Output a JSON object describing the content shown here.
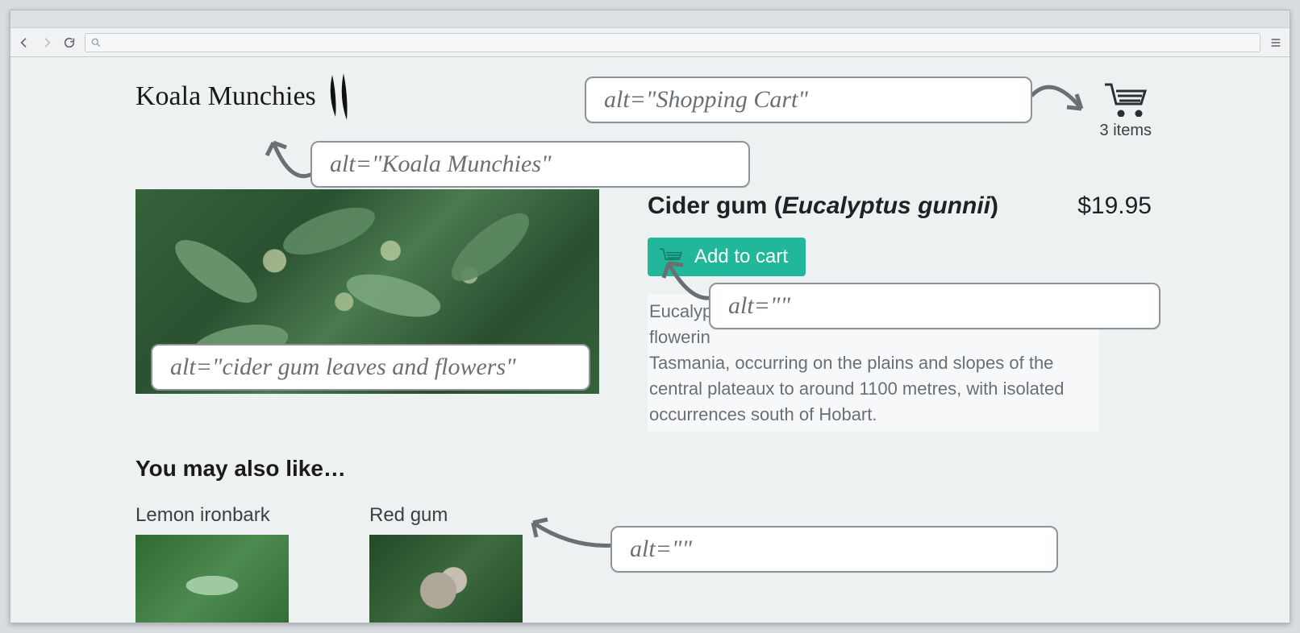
{
  "header": {
    "brand_name": "Koala Munchies",
    "cart_label": "3 items"
  },
  "product": {
    "title_common": "Cider gum",
    "title_open": " (",
    "title_scientific": "Eucalyptus gunnii",
    "title_close": ")",
    "price": "$19.95",
    "add_label": "Add to cart",
    "description_visible_1": "Eucalyp",
    "description_visible_2": "flowerin",
    "description_visible_3": "Tasmania, occurring on the plains and slopes of the central plateaux to around 1100 metres, with isolated occurrences south of Hobart."
  },
  "related": {
    "heading": "You may also like…",
    "items": [
      {
        "title": "Lemon ironbark"
      },
      {
        "title": "Red gum"
      }
    ]
  },
  "annotations": {
    "cart_alt": "alt=\"Shopping Cart\"",
    "logo_alt": "alt=\"Koala Munchies\"",
    "hero_alt": "alt=\"cider gum leaves and flowers\"",
    "btn_alt": "alt=\"\"",
    "thumb_alt": "alt=\"\""
  }
}
